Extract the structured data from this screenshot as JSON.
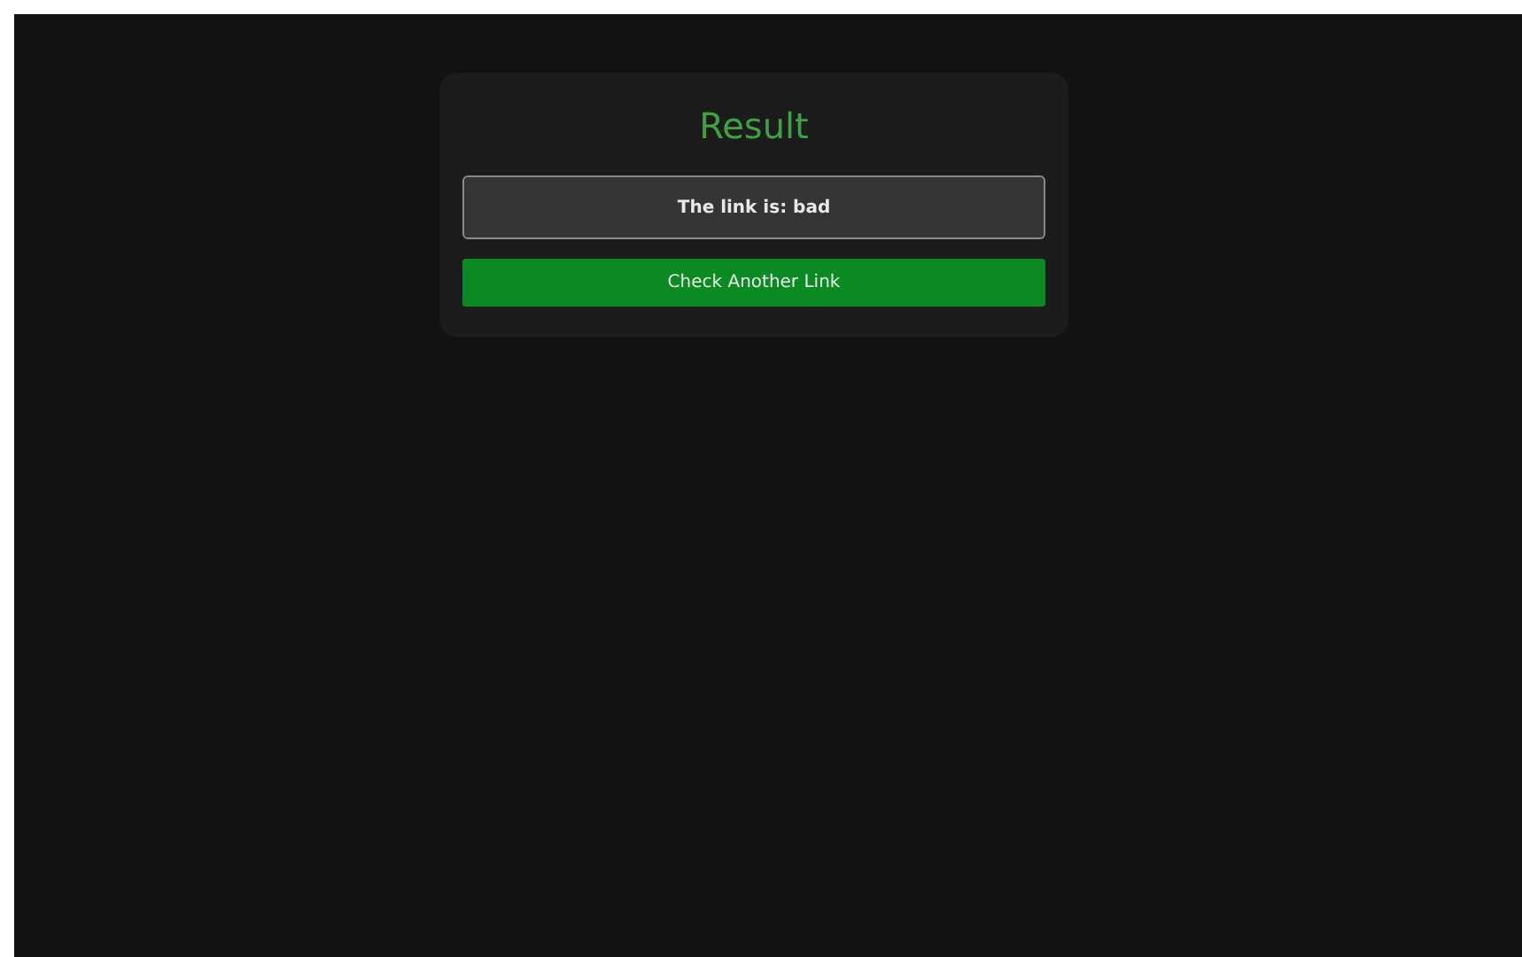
{
  "card": {
    "title": "Result",
    "result": "The link is: bad",
    "button": "Check Another Link"
  }
}
